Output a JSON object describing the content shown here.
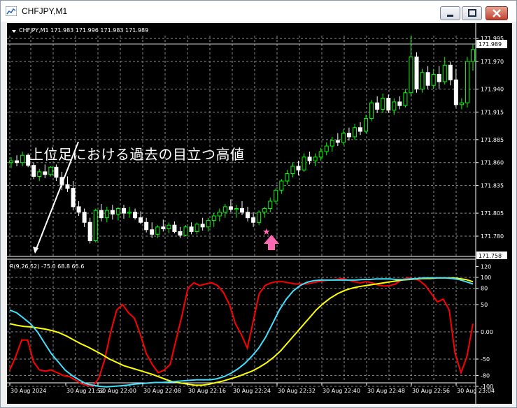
{
  "window": {
    "title": "CHFJPY,M1",
    "buttons": [
      "minimize",
      "restore",
      "close"
    ]
  },
  "chart_header": {
    "text": "CHFJPY,M1  171.983 171.996 171.983 171.989"
  },
  "annotation": {
    "text": "上位足における過去の目立つ高値"
  },
  "colors": {
    "bull_candle": "#ffffff",
    "bear_candle": "#00ff00",
    "grid": "#8a8a8a",
    "arrow": "#ff69b4",
    "stoch_red": "#ff0000",
    "stoch_yellow": "#ffff00",
    "stoch_cyan": "#40e0ff"
  },
  "chart_data": [
    {
      "type": "candlestick",
      "title": "CHFJPY,M1",
      "ylim": [
        171.758,
        172.004
      ],
      "y_ticks": [
        "171.995",
        "171.970",
        "171.940",
        "171.915",
        "171.885",
        "171.860",
        "171.835",
        "171.805",
        "171.780"
      ],
      "current_price": "171.989",
      "bottom_price": "171.758",
      "candles": [
        [
          171.86,
          171.866,
          171.854,
          171.862
        ],
        [
          171.862,
          171.868,
          171.856,
          171.86
        ],
        [
          171.86,
          171.872,
          171.856,
          171.868
        ],
        [
          171.868,
          171.87,
          171.855,
          171.857
        ],
        [
          171.857,
          171.86,
          171.842,
          171.845
        ],
        [
          171.845,
          171.853,
          171.84,
          171.85
        ],
        [
          171.85,
          171.858,
          171.843,
          171.847
        ],
        [
          171.847,
          171.856,
          171.845,
          171.855
        ],
        [
          171.855,
          171.858,
          171.84,
          171.844
        ],
        [
          171.844,
          171.85,
          171.83,
          171.836
        ],
        [
          171.836,
          171.845,
          171.828,
          171.832
        ],
        [
          171.832,
          171.84,
          171.808,
          171.812
        ],
        [
          171.812,
          171.818,
          171.802,
          171.806
        ],
        [
          171.806,
          171.81,
          171.79,
          171.795
        ],
        [
          171.795,
          171.8,
          171.772,
          171.775
        ],
        [
          171.775,
          171.81,
          171.773,
          171.808
        ],
        [
          171.808,
          171.815,
          171.796,
          171.8
        ],
        [
          171.8,
          171.812,
          171.795,
          171.808
        ],
        [
          171.808,
          171.814,
          171.798,
          171.804
        ],
        [
          171.804,
          171.812,
          171.797,
          171.81
        ],
        [
          171.81,
          171.814,
          171.799,
          171.805
        ],
        [
          171.805,
          171.812,
          171.8,
          171.806
        ],
        [
          171.806,
          171.81,
          171.798,
          171.8
        ],
        [
          171.8,
          171.807,
          171.793,
          171.795
        ],
        [
          171.795,
          171.8,
          171.784,
          171.787
        ],
        [
          171.787,
          171.795,
          171.778,
          171.782
        ],
        [
          171.782,
          171.792,
          171.778,
          171.79
        ],
        [
          171.79,
          171.798,
          171.785,
          171.788
        ],
        [
          171.788,
          171.795,
          171.783,
          171.792
        ],
        [
          171.792,
          171.796,
          171.783,
          171.785
        ],
        [
          171.785,
          171.79,
          171.778,
          171.781
        ],
        [
          171.781,
          171.792,
          171.78,
          171.79
        ],
        [
          171.79,
          171.795,
          171.782,
          171.785
        ],
        [
          171.785,
          171.795,
          171.782,
          171.793
        ],
        [
          171.793,
          171.8,
          171.786,
          171.79
        ],
        [
          171.79,
          171.8,
          171.785,
          171.797
        ],
        [
          171.797,
          171.805,
          171.79,
          171.802
        ],
        [
          171.802,
          171.81,
          171.796,
          171.806
        ],
        [
          171.806,
          171.815,
          171.8,
          171.812
        ],
        [
          171.812,
          171.82,
          171.806,
          171.809
        ],
        [
          171.809,
          171.814,
          171.8,
          171.81
        ],
        [
          171.81,
          171.818,
          171.803,
          171.806
        ],
        [
          171.806,
          171.812,
          171.796,
          171.8
        ],
        [
          171.8,
          171.806,
          171.79,
          171.795
        ],
        [
          171.795,
          171.808,
          171.792,
          171.806
        ],
        [
          171.806,
          171.812,
          171.8,
          171.81
        ],
        [
          171.81,
          171.822,
          171.806,
          171.818
        ],
        [
          171.818,
          171.832,
          171.815,
          171.83
        ],
        [
          171.83,
          171.842,
          171.826,
          171.84
        ],
        [
          171.84,
          171.852,
          171.836,
          171.848
        ],
        [
          171.848,
          171.86,
          171.844,
          171.856
        ],
        [
          171.856,
          171.862,
          171.846,
          171.852
        ],
        [
          171.852,
          171.87,
          171.85,
          171.866
        ],
        [
          171.866,
          171.872,
          171.858,
          171.862
        ],
        [
          171.862,
          171.87,
          171.856,
          171.866
        ],
        [
          171.866,
          171.876,
          171.862,
          171.872
        ],
        [
          171.872,
          171.882,
          171.868,
          171.878
        ],
        [
          171.878,
          171.888,
          171.872,
          171.884
        ],
        [
          171.884,
          171.892,
          171.878,
          171.882
        ],
        [
          171.882,
          171.896,
          171.879,
          171.892
        ],
        [
          171.892,
          171.898,
          171.884,
          171.888
        ],
        [
          171.888,
          171.902,
          171.885,
          171.898
        ],
        [
          171.898,
          171.904,
          171.89,
          171.894
        ],
        [
          171.894,
          171.912,
          171.892,
          171.908
        ],
        [
          171.908,
          171.928,
          171.905,
          171.925
        ],
        [
          171.925,
          171.932,
          171.914,
          171.918
        ],
        [
          171.918,
          171.935,
          171.914,
          171.93
        ],
        [
          171.93,
          171.934,
          171.914,
          171.917
        ],
        [
          171.917,
          171.93,
          171.912,
          171.926
        ],
        [
          171.926,
          171.932,
          171.918,
          171.922
        ],
        [
          171.922,
          171.94,
          171.92,
          171.936
        ],
        [
          171.936,
          171.998,
          171.932,
          171.975
        ],
        [
          171.975,
          171.98,
          171.936,
          171.94
        ],
        [
          171.94,
          171.962,
          171.936,
          171.958
        ],
        [
          171.958,
          171.965,
          171.94,
          171.944
        ],
        [
          171.944,
          171.962,
          171.94,
          171.956
        ],
        [
          171.956,
          171.965,
          171.94,
          171.948
        ],
        [
          171.948,
          171.975,
          171.945,
          171.966
        ],
        [
          171.966,
          171.97,
          171.944,
          171.95
        ],
        [
          171.95,
          171.962,
          171.92,
          171.923
        ],
        [
          171.923,
          171.93,
          171.918,
          171.925
        ],
        [
          171.925,
          171.975,
          171.92,
          171.97
        ],
        [
          171.97,
          171.989,
          171.96,
          171.983
        ]
      ],
      "x_ticks": [
        "30 Aug 2024",
        "30 Aug 21:52",
        "30 Aug 22:00",
        "30 Aug 22:08",
        "30 Aug 22:16",
        "30 Aug 22:24",
        "30 Aug 22:32",
        "30 Aug 22:40",
        "30 Aug 22:48",
        "30 Aug 22:56",
        "30 Aug 23:04"
      ]
    },
    {
      "type": "line",
      "title": "R(9,26,52) -75.0 68.8 65.6",
      "ylim": [
        -110,
        125
      ],
      "y_ticks": [
        "120",
        "100",
        "80",
        "50",
        "0.00",
        "-50",
        "-80",
        "-100"
      ],
      "series": [
        {
          "name": "R9",
          "color": "#ff0000",
          "values": [
            -70,
            -45,
            -15,
            -15,
            -55,
            -70,
            -72,
            -70,
            -75,
            -80,
            -82,
            -88,
            -95,
            -98,
            -100,
            -85,
            -50,
            0,
            40,
            50,
            35,
            25,
            -5,
            -40,
            -60,
            -75,
            -70,
            -60,
            -15,
            30,
            80,
            90,
            85,
            88,
            90,
            85,
            72,
            50,
            15,
            -5,
            -30,
            20,
            70,
            85,
            90,
            92,
            92,
            90,
            88,
            88,
            88,
            90,
            92,
            94,
            95,
            96,
            98,
            95,
            92,
            90,
            92,
            90,
            86,
            84,
            85,
            88,
            96,
            99,
            98,
            94,
            85,
            70,
            55,
            60,
            40,
            -40,
            -75,
            -45,
            15
          ]
        },
        {
          "name": "R26",
          "color": "#ffff00",
          "values": [
            15,
            12,
            10,
            9,
            7,
            5,
            2,
            -2,
            -8,
            -15,
            -22,
            -28,
            -35,
            -42,
            -50,
            -56,
            -62,
            -66,
            -70,
            -74,
            -78,
            -83,
            -88,
            -92,
            -94,
            -96,
            -98,
            -98,
            -96,
            -93,
            -90,
            -86,
            -82,
            -77,
            -72,
            -65,
            -57,
            -47,
            -35,
            -20,
            -5,
            10,
            25,
            40,
            52,
            62,
            70,
            76,
            80,
            83,
            85,
            87,
            89,
            91,
            93,
            95,
            96,
            97,
            98,
            98,
            99,
            99,
            99,
            98,
            96,
            92
          ]
        },
        {
          "name": "R52",
          "color": "#40e0ff",
          "values": [
            40,
            35,
            25,
            15,
            0,
            -20,
            -40,
            -55,
            -70,
            -80,
            -88,
            -95,
            -98,
            -100,
            -101,
            -100,
            -99,
            -98,
            -96,
            -95,
            -94,
            -93,
            -93,
            -92,
            -91,
            -90,
            -89,
            -88,
            -88,
            -88,
            -86,
            -82,
            -76,
            -68,
            -58,
            -45,
            -30,
            -10,
            15,
            40,
            60,
            75,
            85,
            91,
            94,
            95,
            95,
            95,
            95,
            95,
            95,
            96,
            96,
            97,
            97,
            97,
            96,
            96,
            97,
            98,
            99,
            99,
            99,
            99,
            98,
            96,
            92,
            88
          ]
        }
      ]
    }
  ]
}
